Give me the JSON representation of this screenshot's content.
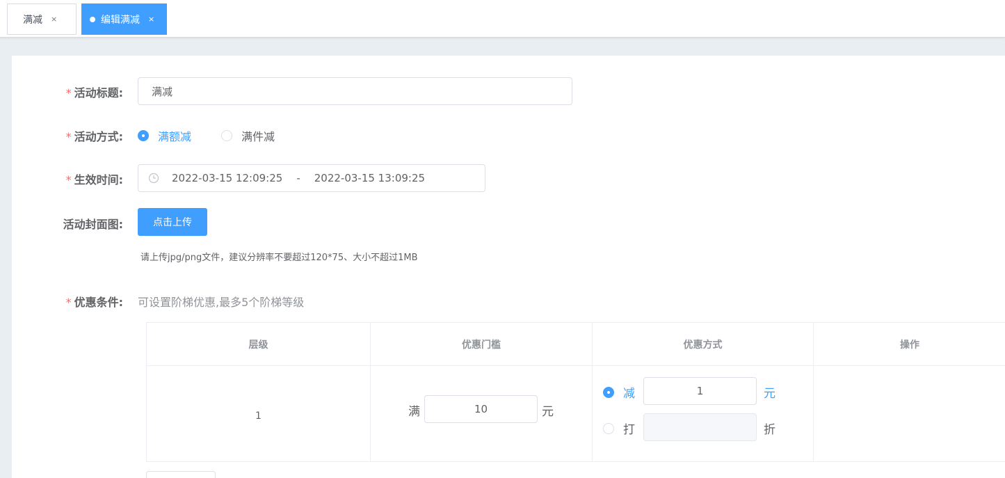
{
  "tabs": [
    {
      "label": "满减",
      "close": "×"
    },
    {
      "label": "编辑满减",
      "close": "×"
    }
  ],
  "form": {
    "title_label": "活动标题:",
    "title_value": "满减",
    "mode_label": "活动方式:",
    "mode_options": [
      "满额减",
      "满件减"
    ],
    "mode_selected": "满额减",
    "time_label": "生效时间:",
    "time_start": "2022-03-15 12:09:25",
    "time_separator": "-",
    "time_end": "2022-03-15 13:09:25",
    "cover_label": "活动封面图:",
    "upload_button": "点击上传",
    "upload_hint": "请上传jpg/png文件，建议分辨率不要超过120*75、大小不超过1MB",
    "condition_label": "优惠条件:",
    "condition_hint": "可设置阶梯优惠,最多5个阶梯等级",
    "required_mark": "*"
  },
  "table": {
    "headers": [
      "层级",
      "优惠门槛",
      "优惠方式",
      "操作"
    ],
    "rows": [
      {
        "level": "1",
        "threshold_prefix": "满",
        "threshold_value": "10",
        "threshold_suffix": "元",
        "discount_reduce_label": "减",
        "discount_reduce_value": "1",
        "discount_reduce_unit": "元",
        "discount_fold_label": "打",
        "discount_fold_value": "",
        "discount_fold_unit": "折",
        "discount_selected": "减"
      }
    ]
  },
  "colors": {
    "accent": "#409eff",
    "required": "#f56c6c",
    "background": "#e9eef3"
  }
}
